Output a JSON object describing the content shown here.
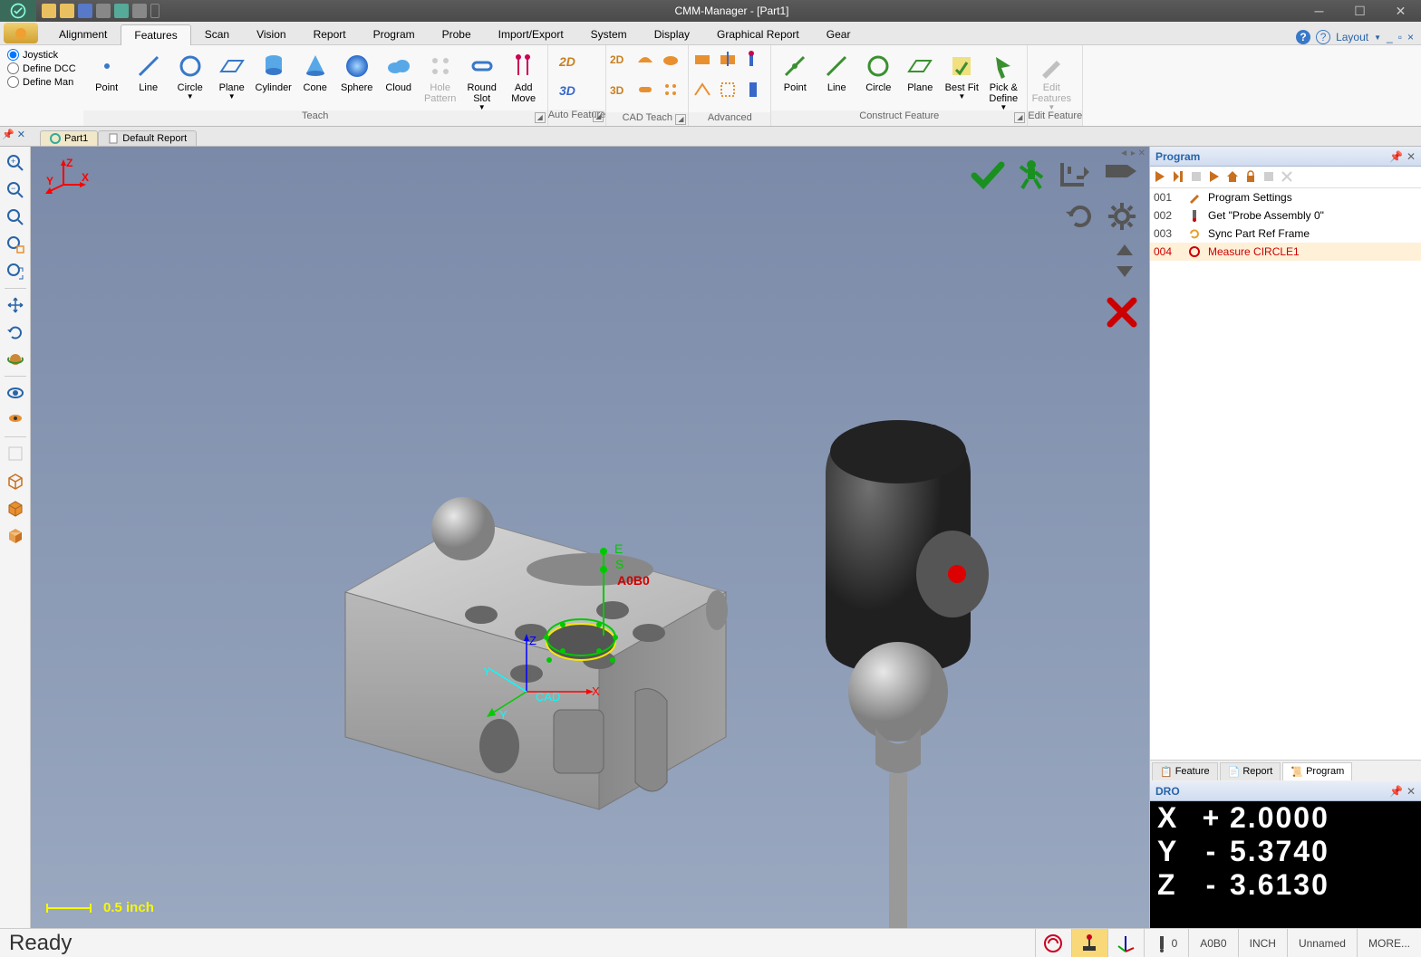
{
  "window": {
    "title": "CMM-Manager - [Part1]"
  },
  "ribbon_tabs": [
    "Alignment",
    "Features",
    "Scan",
    "Vision",
    "Report",
    "Program",
    "Probe",
    "Import/Export",
    "System",
    "Display",
    "Graphical Report",
    "Gear"
  ],
  "active_ribbon_tab": "Features",
  "layout_menu": "Layout",
  "teach_modes": {
    "joystick": "Joystick",
    "dcc": "Define DCC",
    "man": "Define Man",
    "selected": "joystick"
  },
  "ribbon_groups": {
    "teach": {
      "label": "Teach",
      "buttons": [
        "Point",
        "Line",
        "Circle",
        "Plane",
        "Cylinder",
        "Cone",
        "Sphere",
        "Cloud",
        "Hole Pattern",
        "Round Slot",
        "Add Move"
      ]
    },
    "auto": {
      "label": "Auto Feature"
    },
    "cad": {
      "label": "CAD Teach"
    },
    "adv": {
      "label": "Advanced"
    },
    "construct": {
      "label": "Construct Feature",
      "buttons": [
        "Point",
        "Line",
        "Circle",
        "Plane",
        "Best Fit",
        "Pick & Define"
      ]
    },
    "edit": {
      "label": "Edit Feature",
      "button": "Edit Features"
    }
  },
  "doc_tabs": {
    "part": "Part1",
    "report": "Default Report"
  },
  "viewport": {
    "axis_hint_top": {
      "z": "Z",
      "y": "Y",
      "x": "X"
    },
    "axis_hint_cad": {
      "z": "Z",
      "y": "Y",
      "x": "X",
      "cad": "CAD"
    },
    "probe_label": "A0B0",
    "marker_e": "E",
    "marker_s": "S",
    "scale": "0.5 inch"
  },
  "program_panel": {
    "title": "Program",
    "rows": [
      {
        "num": "001",
        "text": "Program Settings",
        "icon": "wrench"
      },
      {
        "num": "002",
        "text": "Get \"Probe Assembly 0\"",
        "icon": "probe"
      },
      {
        "num": "003",
        "text": "Sync Part Ref Frame",
        "icon": "sync"
      },
      {
        "num": "004",
        "text": "Measure CIRCLE1",
        "icon": "circle",
        "selected": true
      }
    ],
    "bottom_tabs": [
      "Feature",
      "Report",
      "Program"
    ],
    "active_bottom_tab": "Program"
  },
  "dro": {
    "title": "DRO",
    "x": {
      "sign": "+",
      "val": "2.0000"
    },
    "y": {
      "sign": "-",
      "val": "5.3740"
    },
    "z": {
      "sign": "-",
      "val": "3.6130"
    }
  },
  "statusbar": {
    "text": "Ready",
    "angle": "0",
    "probe": "A0B0",
    "unit": "INCH",
    "cs": "Unnamed",
    "more": "MORE..."
  }
}
